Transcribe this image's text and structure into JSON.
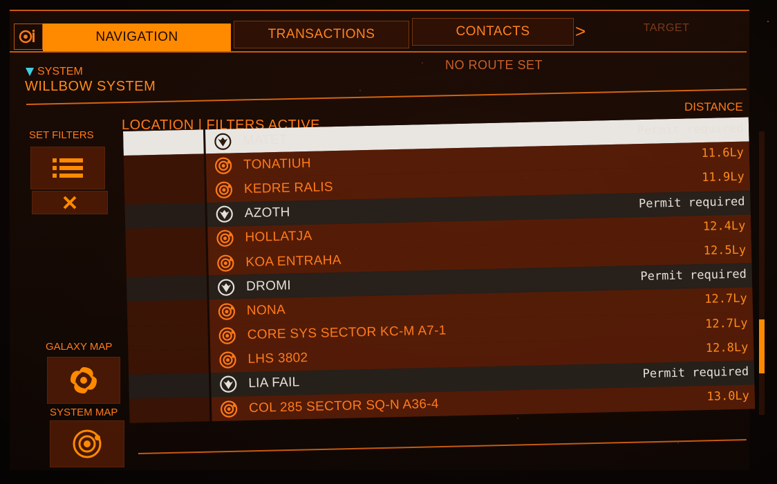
{
  "tabs": [
    {
      "label": "NAVIGATION",
      "state": "active"
    },
    {
      "label": "TRANSACTIONS",
      "state": "inactive"
    },
    {
      "label": "CONTACTS",
      "state": "inactive"
    },
    {
      "label": "TARGET",
      "state": "faded"
    }
  ],
  "tab_arrow": ">",
  "header": {
    "system_label": "SYSTEM",
    "system_name": "WILLBOW SYSTEM",
    "route_status": "NO ROUTE SET"
  },
  "list_header": {
    "location": "LOCATION | FILTERS ACTIVE",
    "distance": "DISTANCE"
  },
  "left_panel": {
    "set_filters": "SET FILTERS",
    "galaxy_map": "GALAXY MAP",
    "system_map": "SYSTEM MAP"
  },
  "rows": [
    {
      "name": "MATET",
      "right": "Permit required",
      "permit": true,
      "selected": true
    },
    {
      "name": "TONATIUH",
      "right": "11.6Ly",
      "permit": false,
      "selected": false
    },
    {
      "name": "KEDRE RALIS",
      "right": "11.9Ly",
      "permit": false,
      "selected": false
    },
    {
      "name": "AZOTH",
      "right": "Permit required",
      "permit": true,
      "selected": false
    },
    {
      "name": "HOLLATJA",
      "right": "12.4Ly",
      "permit": false,
      "selected": false
    },
    {
      "name": "KOA ENTRAHA",
      "right": "12.5Ly",
      "permit": false,
      "selected": false
    },
    {
      "name": "DROMI",
      "right": "Permit required",
      "permit": true,
      "selected": false
    },
    {
      "name": "NONA",
      "right": "12.7Ly",
      "permit": false,
      "selected": false
    },
    {
      "name": "CORE SYS SECTOR KC-M A7-1",
      "right": "12.7Ly",
      "permit": false,
      "selected": false
    },
    {
      "name": "LHS 3802",
      "right": "12.8Ly",
      "permit": false,
      "selected": false
    },
    {
      "name": "LIA FAIL",
      "right": "Permit required",
      "permit": true,
      "selected": false
    },
    {
      "name": "COL 285 SECTOR SQ-N A36-4",
      "right": "13.0Ly",
      "permit": false,
      "selected": false
    }
  ],
  "colors": {
    "accent": "#ff8a00",
    "row_orange": "#6e2408",
    "row_permit": "#2a2420",
    "selected": "#e9e6e2"
  }
}
